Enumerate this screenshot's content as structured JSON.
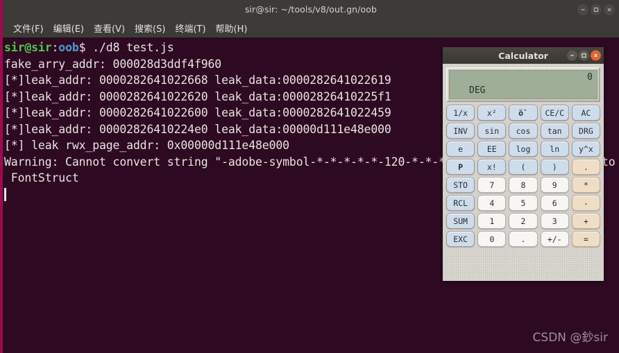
{
  "terminal": {
    "titlebar": {
      "title": "sir@sir: ~/tools/v8/out.gn/oob",
      "minimize_label": "–",
      "maximize_label": "□",
      "close_label": "×"
    },
    "menu": [
      {
        "label": "文件(F)"
      },
      {
        "label": "编辑(E)"
      },
      {
        "label": "查看(V)"
      },
      {
        "label": "搜索(S)"
      },
      {
        "label": "终端(T)"
      },
      {
        "label": "帮助(H)"
      }
    ],
    "prompt": {
      "user_host": "sir@sir",
      "colon": ":",
      "dir": "oob",
      "command": "$ ./d8 test.js"
    },
    "output_lines": [
      "fake_arry_addr: 000028d3ddf4f960",
      "[*]leak_addr: 0000282641022668 leak_data:0000282641022619",
      "[*]leak_addr: 0000282641022620 leak_data:00002826410225f1",
      "[*]leak_addr: 0000282641022600 leak_data:0000282641022459",
      "[*]leak_addr: 00002826410224e0 leak_data:00000d111e48e000",
      "[*] leak rwx_page_addr: 0x00000d111e48e000",
      "Warning: Cannot convert string \"-adobe-symbol-*-*-*-*-*-120-*-*-*-*-adobe-fontspecific\" to type",
      " FontStruct"
    ],
    "watermark": "CSDN @鈔sir"
  },
  "calculator": {
    "titlebar": {
      "title": "Calculator",
      "minimize_label": "–",
      "maximize_label": "□",
      "close_label": "×"
    },
    "display": {
      "value": "0",
      "mode": "DEG"
    },
    "rows": [
      [
        {
          "label": "1/x",
          "kind": "fn"
        },
        {
          "label": "x²",
          "kind": "fn"
        },
        {
          "label": "ö`",
          "kind": "fn bold"
        },
        {
          "label": "CE/C",
          "kind": "fn"
        },
        {
          "label": "AC",
          "kind": "fn"
        }
      ],
      [
        {
          "label": "INV",
          "kind": "fn"
        },
        {
          "label": "sin",
          "kind": "fn"
        },
        {
          "label": "cos",
          "kind": "fn"
        },
        {
          "label": "tan",
          "kind": "fn"
        },
        {
          "label": "DRG",
          "kind": "fn"
        }
      ],
      [
        {
          "label": "e",
          "kind": "fn"
        },
        {
          "label": "EE",
          "kind": "fn"
        },
        {
          "label": "log",
          "kind": "fn"
        },
        {
          "label": "ln",
          "kind": "fn"
        },
        {
          "label": "y^x",
          "kind": "fn"
        }
      ],
      [
        {
          "label": "P",
          "kind": "fn bold"
        },
        {
          "label": "x!",
          "kind": "fn"
        },
        {
          "label": "(",
          "kind": "fn"
        },
        {
          "label": ")",
          "kind": "fn"
        },
        {
          "label": ".",
          "kind": "op"
        }
      ],
      [
        {
          "label": "STO",
          "kind": "fn"
        },
        {
          "label": "7",
          "kind": "num"
        },
        {
          "label": "8",
          "kind": "num"
        },
        {
          "label": "9",
          "kind": "num"
        },
        {
          "label": "*",
          "kind": "op"
        }
      ],
      [
        {
          "label": "RCL",
          "kind": "fn"
        },
        {
          "label": "4",
          "kind": "num"
        },
        {
          "label": "5",
          "kind": "num"
        },
        {
          "label": "6",
          "kind": "num"
        },
        {
          "label": "-",
          "kind": "op"
        }
      ],
      [
        {
          "label": "SUM",
          "kind": "fn"
        },
        {
          "label": "1",
          "kind": "num"
        },
        {
          "label": "2",
          "kind": "num"
        },
        {
          "label": "3",
          "kind": "num"
        },
        {
          "label": "+",
          "kind": "op"
        }
      ],
      [
        {
          "label": "EXC",
          "kind": "fn"
        },
        {
          "label": "0",
          "kind": "num"
        },
        {
          "label": ".",
          "kind": "num"
        },
        {
          "label": "+/-",
          "kind": "num"
        },
        {
          "label": "=",
          "kind": "op"
        }
      ]
    ]
  },
  "colors": {
    "terminal_bg": "#2d0922",
    "terminal_border": "#9b0b4e",
    "titlebar_bg": "#3c3b37",
    "prompt_green": "#4ec94e",
    "prompt_blue": "#4e9ad6",
    "calc_body": "#d9d5cf",
    "calc_display": "#9fae96",
    "calc_close": "#e8622a"
  }
}
